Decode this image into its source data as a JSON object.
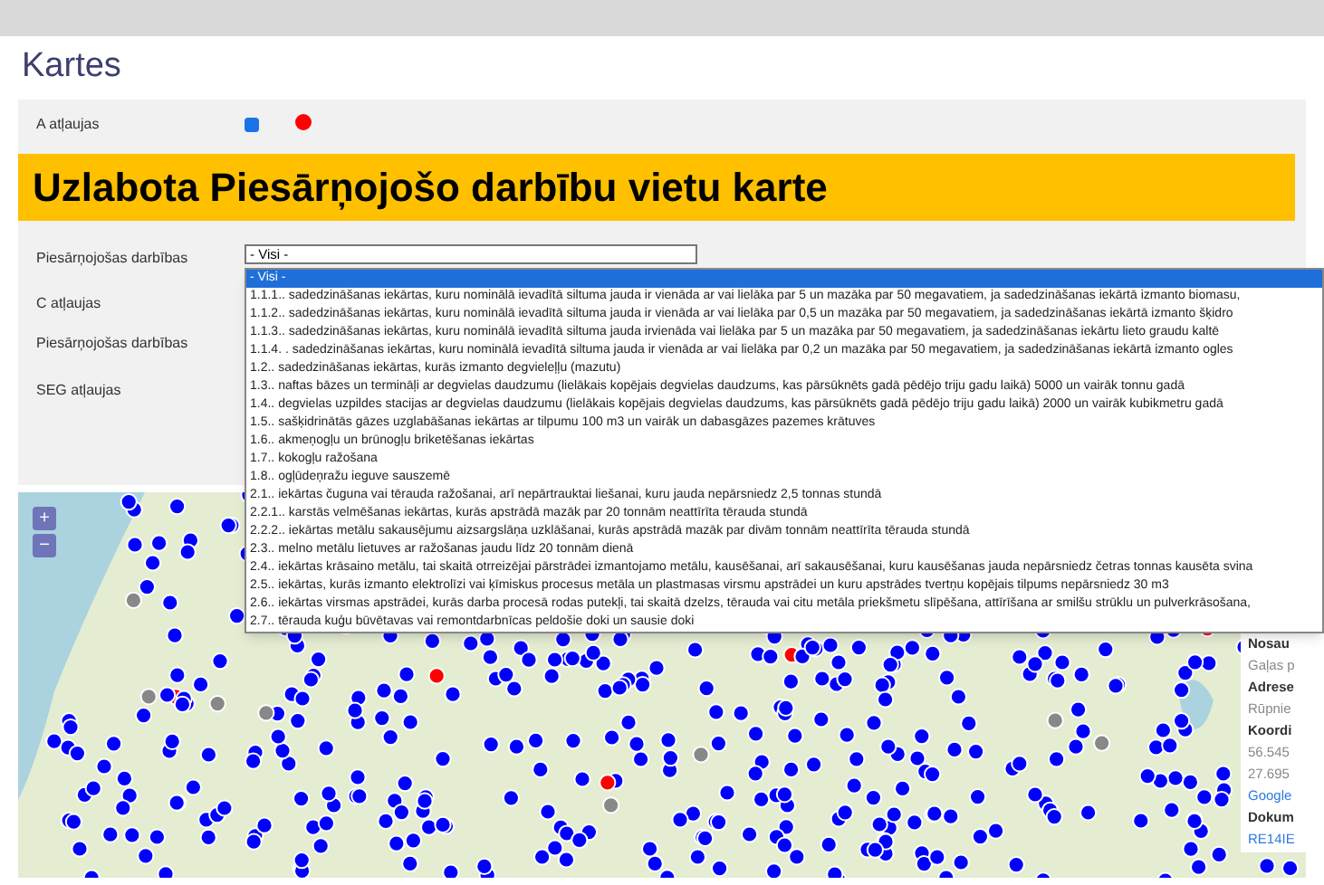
{
  "page_title": "Kartes",
  "banner": "Uzlabota Piesārņojošo darbību vietu karte",
  "filters": [
    {
      "label": "A atļaujas",
      "kind": "checkbox",
      "checked": true,
      "color": "#ff0000"
    },
    {
      "label": "Piesārņojošas darbības",
      "kind": "select",
      "value": "- Visi -"
    },
    {
      "label": "C atļaujas",
      "kind": "label"
    },
    {
      "label": "Piesārņojošas darbības",
      "kind": "label"
    },
    {
      "label": "SEG atļaujas",
      "kind": "label"
    }
  ],
  "dropdown": {
    "options": [
      {
        "label": "- Visi -",
        "selected": true
      },
      {
        "label": "1.1.1.. sadedzināšanas iekārtas, kuru nominālā ievadītā siltuma jauda ir vienāda ar vai lielāka par 5 un mazāka par 50 megavatiem, ja sadedzināšanas iekārtā izmanto biomasu,",
        "selected": false
      },
      {
        "label": "1.1.2.. sadedzināšanas iekārtas, kuru nominālā ievadītā siltuma jauda ir vienāda ar vai lielāka par 0,5 un mazāka par 50 megavatiem, ja sadedzināšanas iekārtā izmanto šķidro",
        "selected": false
      },
      {
        "label": "1.1.3.. sadedzināšanas iekārtas, kuru nominālā ievadītā siltuma jauda irvienāda vai lielāka par 5 un mazāka par 50 megavatiem, ja sadedzināšanas iekārtu lieto graudu kaltē",
        "selected": false
      },
      {
        "label": "1.1.4. . sadedzināšanas iekārtas, kuru nominālā ievadītā siltuma jauda ir vienāda ar vai lielāka par 0,2 un mazāka par 50 megavatiem, ja sadedzināšanas iekārtā izmanto ogles",
        "selected": false
      },
      {
        "label": "1.2.. sadedzināšanas iekārtas, kurās izmanto degvieleļļu (mazutu)",
        "selected": false
      },
      {
        "label": "1.3.. naftas bāzes un termināļi ar degvielas daudzumu (lielākais kopējais degvielas daudzums, kas pārsūknēts gadā pēdējo triju gadu laikā) 5000 un vairāk tonnu gadā",
        "selected": false
      },
      {
        "label": "1.4.. degvielas uzpildes stacijas ar degvielas daudzumu (lielākais kopējais degvielas daudzums, kas pārsūknēts gadā pēdējo triju gadu laikā) 2000 un vairāk kubikmetru gadā",
        "selected": false
      },
      {
        "label": "1.5.. sašķidrinātās gāzes uzglabāšanas iekārtas ar tilpumu 100 m3 un vairāk un dabasgāzes pazemes krātuves",
        "selected": false
      },
      {
        "label": "1.6.. akmeņogļu un brūnogļu briketēšanas iekārtas",
        "selected": false
      },
      {
        "label": "1.7.. kokogļu ražošana",
        "selected": false
      },
      {
        "label": "1.8.. ogļūdeņražu ieguve sauszemē",
        "selected": false
      },
      {
        "label": "2.1.. iekārtas čuguna vai tērauda ražošanai, arī nepārtrauktai liešanai, kuru jauda nepārsniedz 2,5 tonnas stundā",
        "selected": false
      },
      {
        "label": "2.2.1.. karstās velmēšanas iekārtas, kurās apstrādā mazāk par 20 tonnām neattīrīta tērauda stundā",
        "selected": false
      },
      {
        "label": "2.2.2.. iekārtas metālu sakausējumu aizsargslāņa uzklāšanai, kurās apstrādā mazāk par divām tonnām neattīrīta tērauda stundā",
        "selected": false
      },
      {
        "label": "2.3.. melno metālu lietuves ar ražošanas jaudu līdz 20 tonnām dienā",
        "selected": false
      },
      {
        "label": "2.4.. iekārtas krāsaino metālu, tai skaitā otrreizējai pārstrādei izmantojamo metālu, kausēšanai, arī sakausēšanai, kuru kausēšanas jauda nepārsniedz četras tonnas kausēta svina",
        "selected": false
      },
      {
        "label": "2.5.. iekārtas, kurās izmanto elektrolīzi vai ķīmiskus procesus metāla un plastmasas virsmu apstrādei un kuru apstrādes tvertņu kopējais tilpums nepārsniedz 30 m3",
        "selected": false
      },
      {
        "label": "2.6.. iekārtas virsmas apstrādei, kurās darba procesā rodas putekļi, tai skaitā dzelzs, tērauda vai citu metāla priekšmetu slīpēšana, attīrīšana ar smilšu strūklu un pulverkrāsošana,",
        "selected": false
      },
      {
        "label": "2.7.. tērauda kuģu būvētavas vai remontdarbnīcas peldošie doki un sausie doki",
        "selected": false
      }
    ]
  },
  "map": {
    "zoom_in": "+",
    "zoom_out": "−",
    "popup": [
      {
        "kind": "heading",
        "text": "Nosau"
      },
      {
        "kind": "text",
        "text": "Gaļas p"
      },
      {
        "kind": "heading",
        "text": "Adrese"
      },
      {
        "kind": "text",
        "text": "Rūpnie"
      },
      {
        "kind": "heading",
        "text": "Koordi"
      },
      {
        "kind": "text",
        "text": "56.545"
      },
      {
        "kind": "text",
        "text": "27.695"
      },
      {
        "kind": "link",
        "text": "Google"
      },
      {
        "kind": "heading",
        "text": "Dokum"
      },
      {
        "kind": "link",
        "text": "RE14IE"
      }
    ]
  }
}
